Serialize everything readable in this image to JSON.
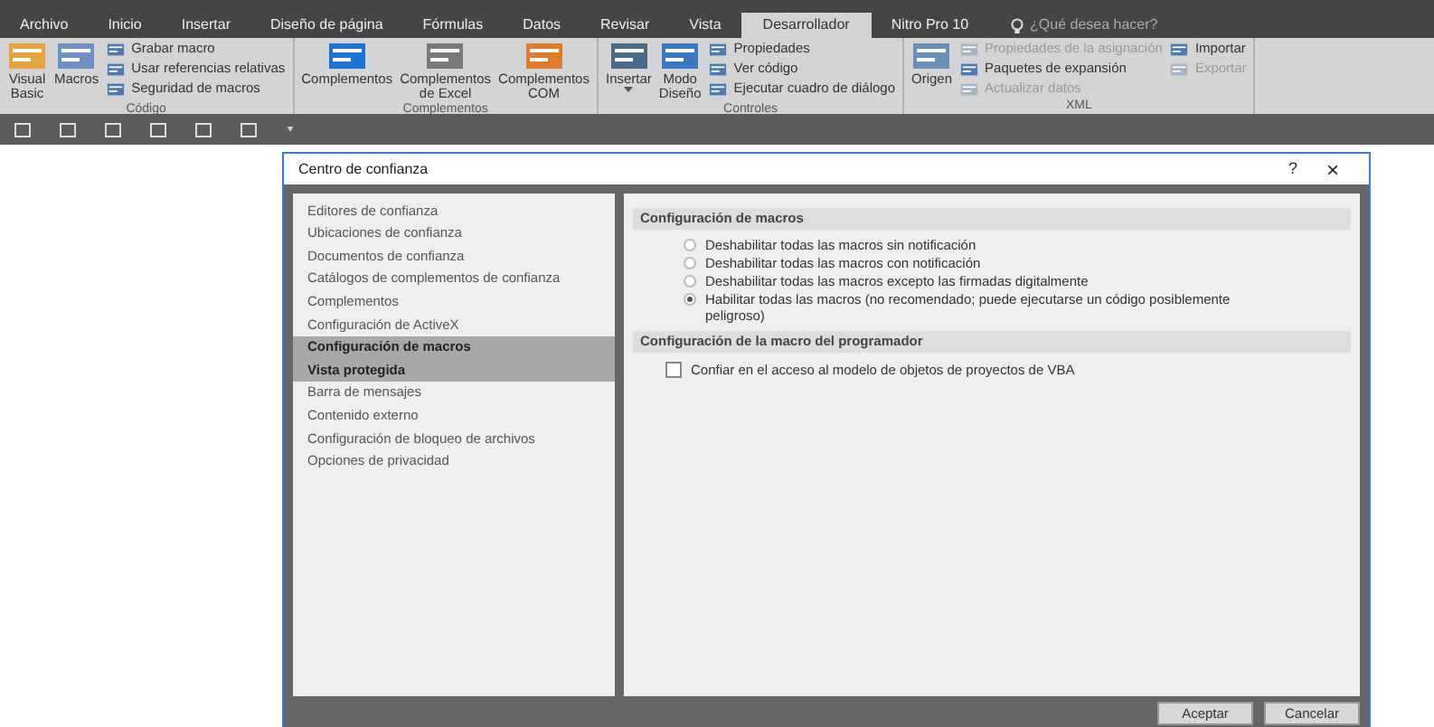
{
  "ribbon": {
    "tabs": [
      {
        "label": "Archivo",
        "selected": false
      },
      {
        "label": "Inicio",
        "selected": false
      },
      {
        "label": "Insertar",
        "selected": false
      },
      {
        "label": "Diseño de página",
        "selected": false
      },
      {
        "label": "Fórmulas",
        "selected": false
      },
      {
        "label": "Datos",
        "selected": false
      },
      {
        "label": "Revisar",
        "selected": false
      },
      {
        "label": "Vista",
        "selected": false
      },
      {
        "label": "Desarrollador",
        "selected": true
      },
      {
        "label": "Nitro Pro 10",
        "selected": false
      }
    ],
    "search": {
      "placeholder": "¿Qué desea hacer?"
    },
    "groups": [
      {
        "label": "Código",
        "items": [
          {
            "kind": "large",
            "label": "Visual\nBasic",
            "disabled": false
          },
          {
            "kind": "large",
            "label": "Macros",
            "disabled": false
          },
          {
            "kind": "stack",
            "items": [
              {
                "label": "Grabar macro",
                "disabled": false
              },
              {
                "label": "Usar referencias relativas",
                "disabled": false
              },
              {
                "label": "Seguridad de macros",
                "disabled": false
              }
            ]
          }
        ]
      },
      {
        "label": "Complementos",
        "items": [
          {
            "kind": "large",
            "label": "Complementos",
            "disabled": false
          },
          {
            "kind": "large",
            "label": "Complementos\nde Excel",
            "disabled": false
          },
          {
            "kind": "large",
            "label": "Complementos\nCOM",
            "disabled": false
          }
        ]
      },
      {
        "label": "Controles",
        "items": [
          {
            "kind": "large",
            "label": "Insertar",
            "dropdown": true,
            "disabled": false
          },
          {
            "kind": "large",
            "label": "Modo\nDiseño",
            "disabled": false
          },
          {
            "kind": "stack",
            "items": [
              {
                "label": "Propiedades",
                "disabled": false
              },
              {
                "label": "Ver código",
                "disabled": false
              },
              {
                "label": "Ejecutar cuadro de diálogo",
                "disabled": false
              }
            ]
          }
        ]
      },
      {
        "label": "XML",
        "items": [
          {
            "kind": "large",
            "label": "Origen",
            "disabled": false
          },
          {
            "kind": "stack",
            "items": [
              {
                "label": "Propiedades de la asignación",
                "disabled": true
              },
              {
                "label": "Paquetes de expansión",
                "disabled": false
              },
              {
                "label": "Actualizar datos",
                "disabled": true
              }
            ]
          },
          {
            "kind": "stack",
            "items": [
              {
                "label": "Importar",
                "disabled": false
              },
              {
                "label": "Exportar",
                "disabled": true
              }
            ]
          }
        ]
      }
    ]
  },
  "dialog": {
    "title": "Centro de confianza",
    "help": "?",
    "close": "×",
    "nav": [
      {
        "label": "Editores de confianza",
        "selected": false
      },
      {
        "label": "Ubicaciones de confianza",
        "selected": false
      },
      {
        "label": "Documentos de confianza",
        "selected": false
      },
      {
        "label": "Catálogos de complementos de confianza",
        "selected": false
      },
      {
        "label": "Complementos",
        "selected": false
      },
      {
        "label": "Configuración de ActiveX",
        "selected": false
      },
      {
        "label": "Configuración de macros",
        "selected": true
      },
      {
        "label": "Vista protegida",
        "selected": true
      },
      {
        "label": "Barra de mensajes",
        "selected": false
      },
      {
        "label": "Contenido externo",
        "selected": false
      },
      {
        "label": "Configuración de bloqueo de archivos",
        "selected": false
      },
      {
        "label": "Opciones de privacidad",
        "selected": false
      }
    ],
    "sections": [
      {
        "heading": "Configuración de macros",
        "kind": "radio",
        "options": [
          {
            "label": "Deshabilitar todas las macros sin notificación",
            "selected": false
          },
          {
            "label": "Deshabilitar todas las macros con notificación",
            "selected": false
          },
          {
            "label": "Deshabilitar todas las macros excepto las firmadas digitalmente",
            "selected": false
          },
          {
            "label": "Habilitar todas las macros (no recomendado; puede ejecutarse un código posiblemente peligroso)",
            "selected": true
          }
        ]
      },
      {
        "heading": "Configuración de la macro del programador",
        "kind": "checkbox",
        "options": [
          {
            "label": "Confiar en el acceso al modelo de objetos de proyectos de VBA",
            "checked": false
          }
        ]
      }
    ],
    "buttons": [
      "Aceptar",
      "Cancelar"
    ]
  }
}
